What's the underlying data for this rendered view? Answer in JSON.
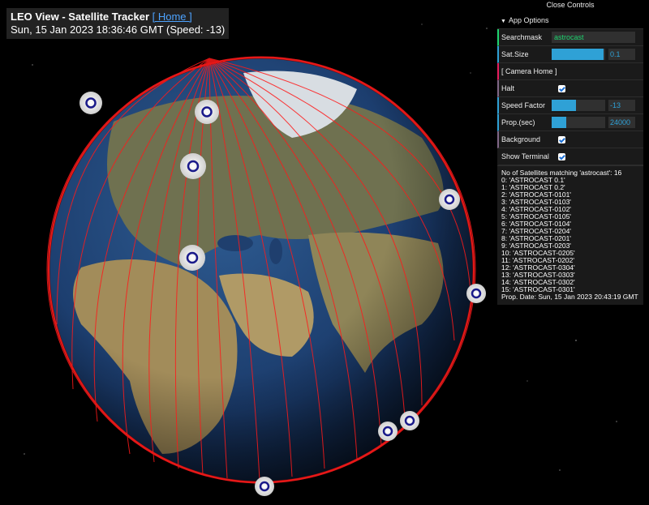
{
  "header": {
    "title": "LEO View - Satellite Tracker",
    "home_link": "[ Home ]",
    "status": "Sun, 15 Jan 2023 18:36:46 GMT (Speed: -13)"
  },
  "controls": {
    "close_label": "Close Controls",
    "folder_label": "App Options",
    "searchmask_label": "Searchmask",
    "searchmask_value": "astrocast",
    "satsize_label": "Sat.Size",
    "satsize_value": "0.1",
    "satsize_fraction": 0.97,
    "camera_home_label": "[ Camera Home ]",
    "halt_label": "Halt",
    "halt_checked": true,
    "speed_label": "Speed Factor",
    "speed_value": "-13",
    "speed_fraction": 0.45,
    "prop_label": "Prop.(sec)",
    "prop_value": "24000",
    "prop_fraction": 0.28,
    "background_label": "Background",
    "background_checked": true,
    "terminal_label": "Show Terminal",
    "terminal_checked": true
  },
  "terminal": {
    "header": "No of Satellites matching 'astrocast': 16",
    "lines": [
      "0: 'ASTROCAST 0.1'",
      "1: 'ASTROCAST 0.2'",
      "2: 'ASTROCAST-0101'",
      "3: 'ASTROCAST-0103'",
      "4: 'ASTROCAST-0102'",
      "5: 'ASTROCAST-0105'",
      "6: 'ASTROCAST-0104'",
      "7: 'ASTROCAST-0204'",
      "8: 'ASTROCAST-0201'",
      "9: 'ASTROCAST-0203'",
      "10: 'ASTROCAST-0205'",
      "11: 'ASTROCAST-0202'",
      "12: 'ASTROCAST-0304'",
      "13: 'ASTROCAST-0303'",
      "14: 'ASTROCAST-0302'",
      "15: 'ASTROCAST-0301'"
    ],
    "footer": "Prop. Date: Sun, 15 Jan 2023 20:43:19 GMT"
  },
  "scene": {
    "orbit_color": "#ff1a1a",
    "ocean_color": "#1d3f73",
    "land_color": "#9a8a5a"
  }
}
